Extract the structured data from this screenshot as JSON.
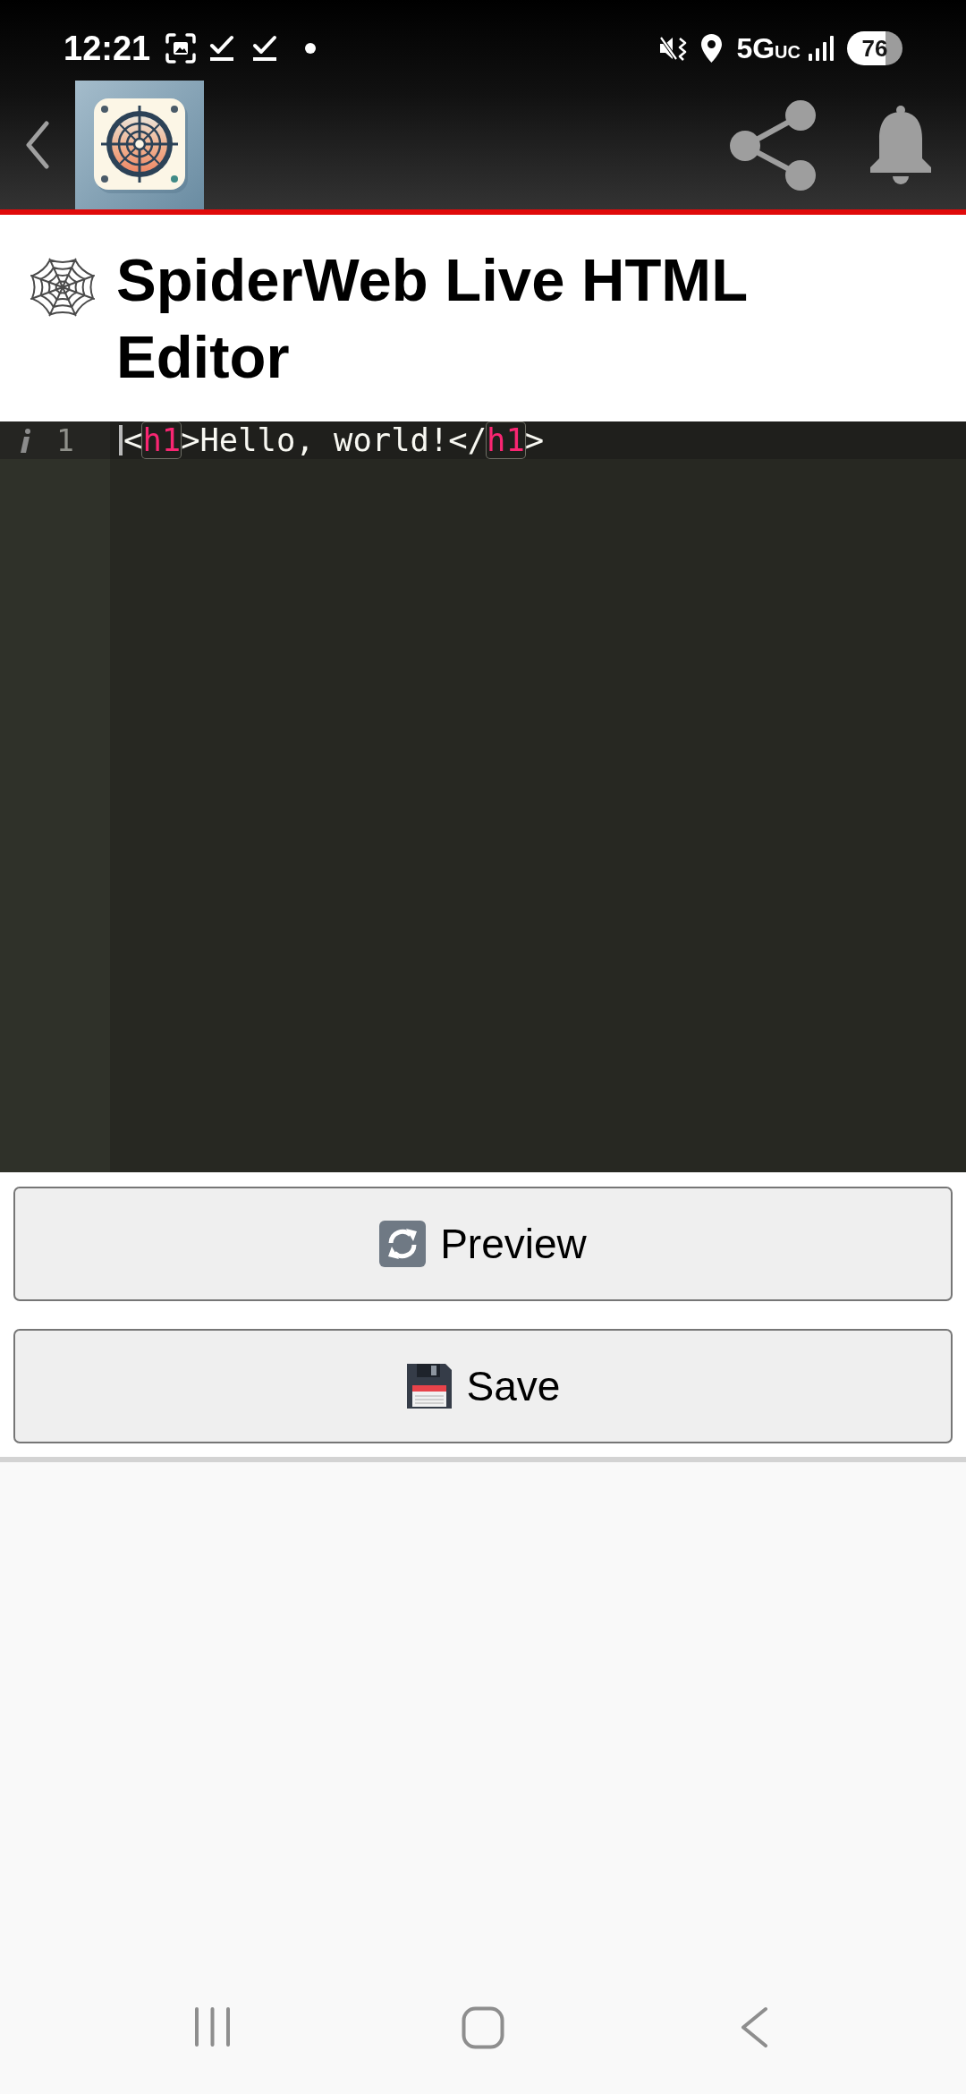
{
  "status_bar": {
    "time": "12:21",
    "network": "5G",
    "network_suffix": "UC",
    "battery": "76"
  },
  "page": {
    "title": "SpiderWeb Live HTML Editor"
  },
  "editor": {
    "lines": [
      {
        "number": "1",
        "active": true,
        "info_marker": true,
        "tokens": [
          {
            "text": "<",
            "kind": "punctuation"
          },
          {
            "text": "h1",
            "kind": "tag",
            "matched": true
          },
          {
            "text": ">",
            "kind": "punctuation"
          },
          {
            "text": "Hello, world!",
            "kind": "text"
          },
          {
            "text": "</",
            "kind": "punctuation"
          },
          {
            "text": "h1",
            "kind": "tag",
            "matched": true
          },
          {
            "text": ">",
            "kind": "punctuation"
          }
        ]
      }
    ]
  },
  "buttons": [
    {
      "label": "Preview",
      "kind": "refresh"
    },
    {
      "label": "Save",
      "kind": "save"
    }
  ]
}
